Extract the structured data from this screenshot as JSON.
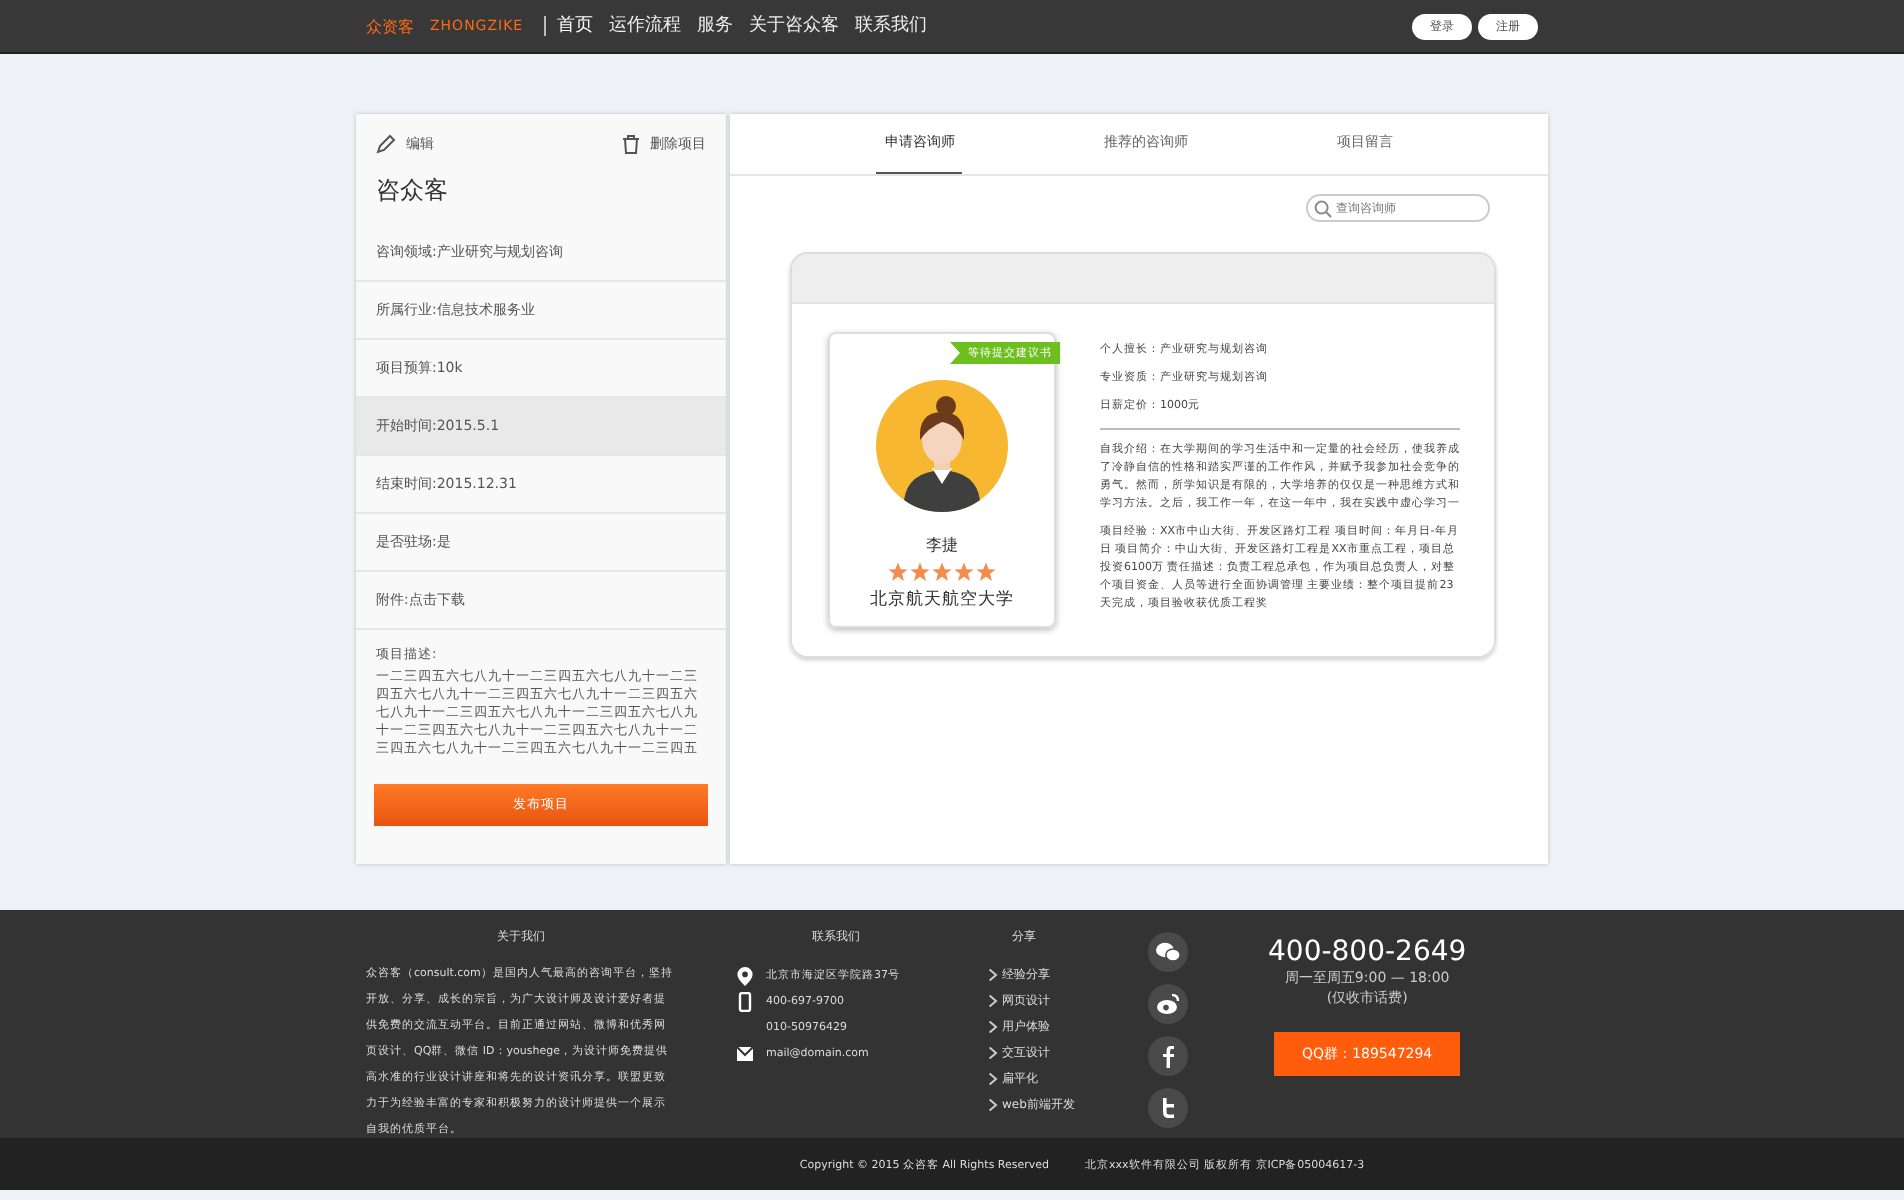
{
  "header": {
    "logo_cn": "众资客",
    "logo_en": "ZHONGZIKE",
    "nav": [
      {
        "label": "首页",
        "selected": true
      },
      {
        "label": "运作流程",
        "selected": false
      },
      {
        "label": "服务",
        "selected": false
      },
      {
        "label": "关于咨众客",
        "selected": false
      },
      {
        "label": "联系我们",
        "selected": false
      }
    ],
    "buttons": [
      "登录",
      "注册"
    ]
  },
  "project": {
    "edit": "编辑",
    "delete": "删除项目",
    "title": "咨众客",
    "fields": [
      {
        "text": "咨询领域:产业研究与规划咨询",
        "selected": false
      },
      {
        "text": "所属行业:信息技术服务业",
        "selected": false
      },
      {
        "text": "项目预算:10k",
        "selected": false
      },
      {
        "text": "开始时间:2015.5.1",
        "selected": true
      },
      {
        "text": "结束时间:2015.12.31",
        "selected": false
      },
      {
        "text": "是否驻场:是",
        "selected": false
      },
      {
        "text": "附件:点击下载",
        "selected": false
      }
    ],
    "description_label": "项目描述:",
    "description": "一二三四五六七八九十一二三四五六七八九十一二三四五六七八九十一二三四五六七八九十一二三四五六七八九十一二三四五六七八九十一二三四五六七八九十一二三四五六七八九十一二三四五六七八九十一二三四五六七八九十一二三四五六七八九十一二三四五",
    "publish": "发布项目"
  },
  "tabs": [
    {
      "label": "申请咨询师",
      "selected": true
    },
    {
      "label": "推荐的咨询师",
      "selected": false
    },
    {
      "label": "项目留言",
      "selected": false
    }
  ],
  "search": {
    "placeholder": "查询咨询师"
  },
  "consultant": {
    "ribbon": "等待提交建议书",
    "name": "李捷",
    "stars": 5,
    "school": "北京航天航空大学",
    "facts": [
      "个人擅长：产业研究与规划咨询",
      "专业资质：产业研究与规划咨询",
      "日薪定价：1000元"
    ],
    "intro": "自我介绍：在大学期间的学习生活中和一定量的社会经历，使我养成了冷静自信的性格和踏实严谨的工作作风，并赋予我参加社会竞争的勇气。然而，所学知识是有限的，大学培养的仅仅是一种思维方式和学习方法。之后，我工作一年，在这一年中，我在实践中虚心学习一",
    "experience": "项目经验：XX市中山大街、开发区路灯工程  项目时间：年月日-年月日  项目简介：中山大街、开发区路灯工程是XX市重点工程，项目总投资6100万  责任描述：负责工程总承包，作为项目总负责人，对整个项目资金、人员等进行全面协调管理  主要业绩：整个项目提前23天完成，项目验收获优质工程奖"
  },
  "footer": {
    "about_title": "关于我们",
    "about": "众咨客（consult.com）是国内人气最高的咨询平台，坚持开放、分享、成长的宗旨，为广大设计师及设计爱好者提供免费的交流互动平台。目前正通过网站、微博和优秀网页设计、QQ群、微信 ID：youshege，为设计师免费提供高水准的行业设计讲座和将先的设计资讯分享。联盟更致力于为经验丰富的专家和积极努力的设计师提供一个展示自我的优质平台。",
    "contact_title": "联系我们",
    "contacts": [
      {
        "kind": "location",
        "text": "北京市海淀区学院路37号"
      },
      {
        "kind": "phone",
        "text": "400-697-9700"
      },
      {
        "kind": "none",
        "text": "010-50976429"
      },
      {
        "kind": "mail",
        "text": "mail@domain.com"
      }
    ],
    "share_title": "分享",
    "share": [
      "经验分享",
      "网页设计",
      "用户体验",
      "交互设计",
      "扁平化",
      "web前端开发"
    ],
    "social": [
      {
        "kind": "wechat"
      },
      {
        "kind": "weibo"
      },
      {
        "kind": "facebook"
      },
      {
        "kind": "twitter"
      }
    ],
    "phone": "400-800-2649",
    "hours": "周一至周五9:00 — 18:00",
    "hours_note": "(仅收市话费)",
    "qq": "QQ群：189547294",
    "copyright": "Copyright © 2015 众咨客  All Rights Reserved",
    "company": "北京xxx软件有限公司 版权所有 京ICP备05004617-3"
  }
}
